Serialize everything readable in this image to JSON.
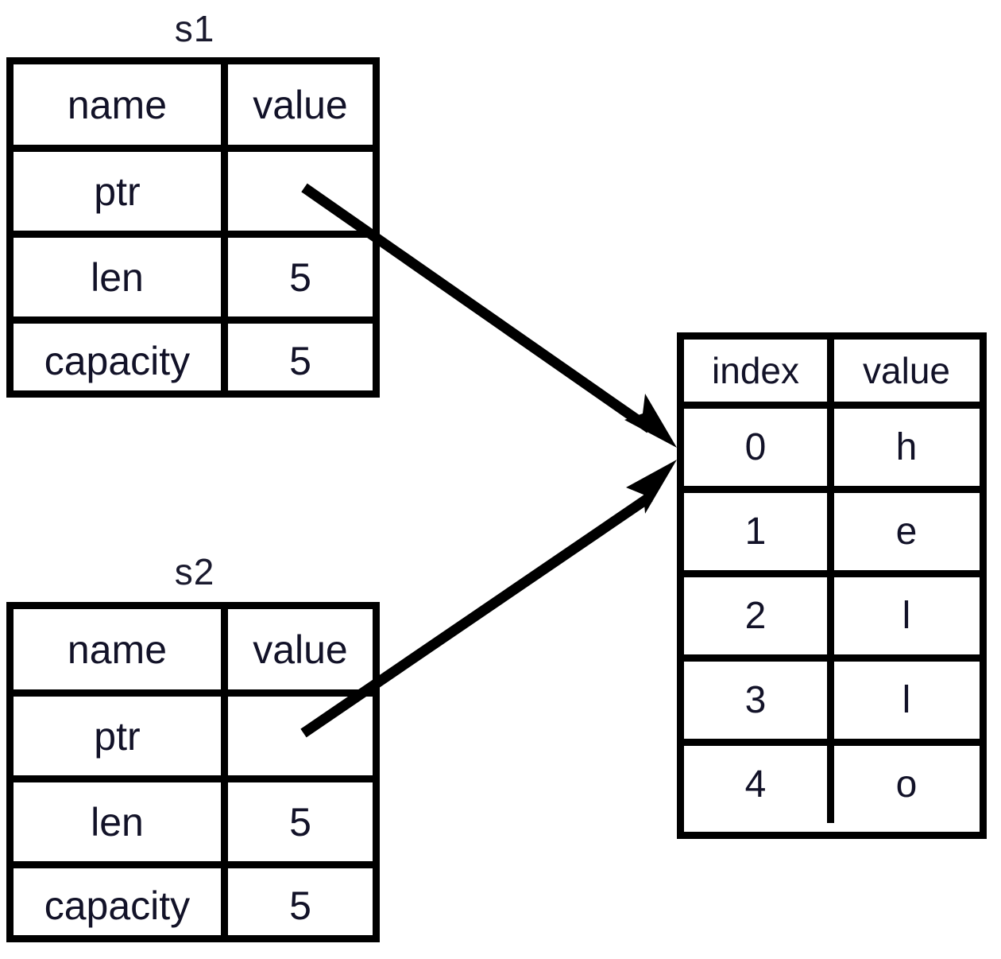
{
  "diagram": {
    "title_s1": "s1",
    "title_s2": "s2",
    "struct_headers": {
      "name": "name",
      "value": "value"
    },
    "struct_s1": {
      "label": "s1",
      "rows": [
        {
          "name": "ptr",
          "value": ""
        },
        {
          "name": "len",
          "value": "5"
        },
        {
          "name": "capacity",
          "value": "5"
        }
      ]
    },
    "struct_s2": {
      "label": "s2",
      "rows": [
        {
          "name": "ptr",
          "value": ""
        },
        {
          "name": "len",
          "value": "5"
        },
        {
          "name": "capacity",
          "value": "5"
        }
      ]
    },
    "heap_table": {
      "headers": {
        "index": "index",
        "value": "value"
      },
      "rows": [
        {
          "index": "0",
          "value": "h"
        },
        {
          "index": "1",
          "value": "e"
        },
        {
          "index": "2",
          "value": "l"
        },
        {
          "index": "3",
          "value": "l"
        },
        {
          "index": "4",
          "value": "o"
        }
      ]
    },
    "arrows": [
      {
        "from": "s1-ptr-value",
        "to": "heap-row-0"
      },
      {
        "from": "s2-ptr-value",
        "to": "heap-row-0"
      }
    ],
    "colors": {
      "stroke": "#000000",
      "text": "#121228",
      "background": "#ffffff"
    }
  }
}
